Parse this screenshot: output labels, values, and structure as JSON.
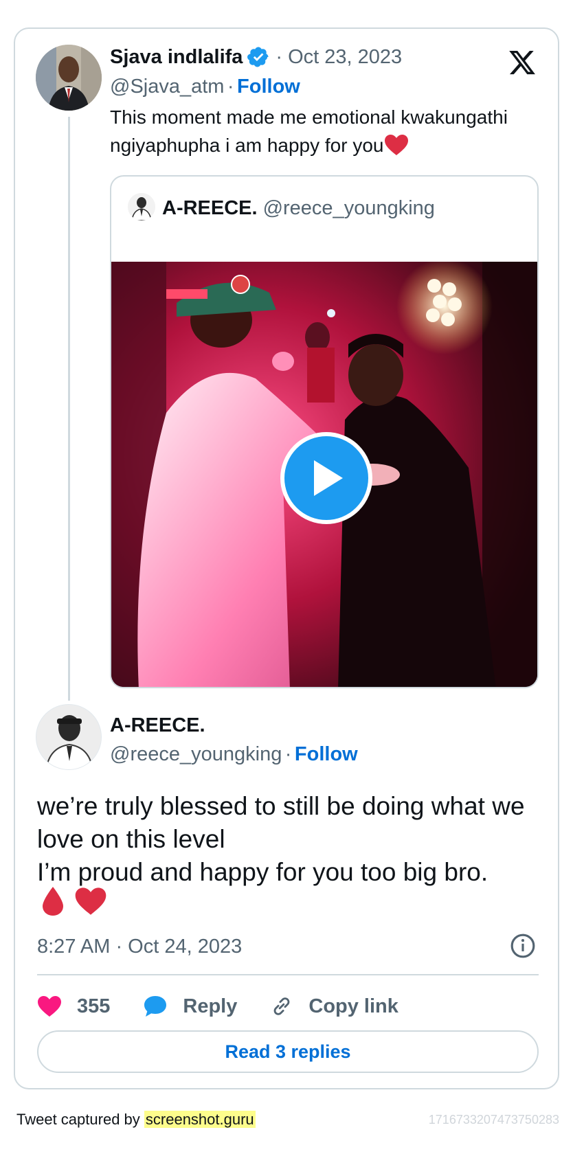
{
  "replied_tweet": {
    "author_name": "Sjava indlalifa",
    "separator": "·",
    "date": "Oct 23, 2023",
    "handle": "@Sjava_atm",
    "follow_label": "Follow",
    "text": "This moment made me emotional kwakungathi ngiyaphupha i am happy for you",
    "verified_icon": "verified-badge-icon",
    "verified_color": "#1d9bf0"
  },
  "quoted_tweet": {
    "author_name": "A-REECE.",
    "handle": "@reece_youngking",
    "media": "video",
    "play_icon": "play-icon"
  },
  "main_tweet": {
    "author_name": "A-REECE.",
    "handle": "@reece_youngking",
    "follow_label": "Follow",
    "text": "we’re truly blessed to still be doing what we love on this level\nI’m proud and happy for you too big bro.",
    "emojis": [
      "drop-of-blood-icon",
      "red-heart-icon"
    ],
    "timestamp": "8:27 AM · Oct 24, 2023"
  },
  "actions": {
    "like_count": "355",
    "reply_label": "Reply",
    "copy_link_label": "Copy link",
    "read_replies_label": "Read 3 replies"
  },
  "footer": {
    "captured_by": "Tweet captured by ",
    "site": "screenshot.guru",
    "tweet_id": "1716733207473750283"
  },
  "colors": {
    "accent": "#006fd6",
    "like": "#f91880",
    "play": "#1d9bf0",
    "border": "#cfd9de",
    "muted": "#536471"
  }
}
